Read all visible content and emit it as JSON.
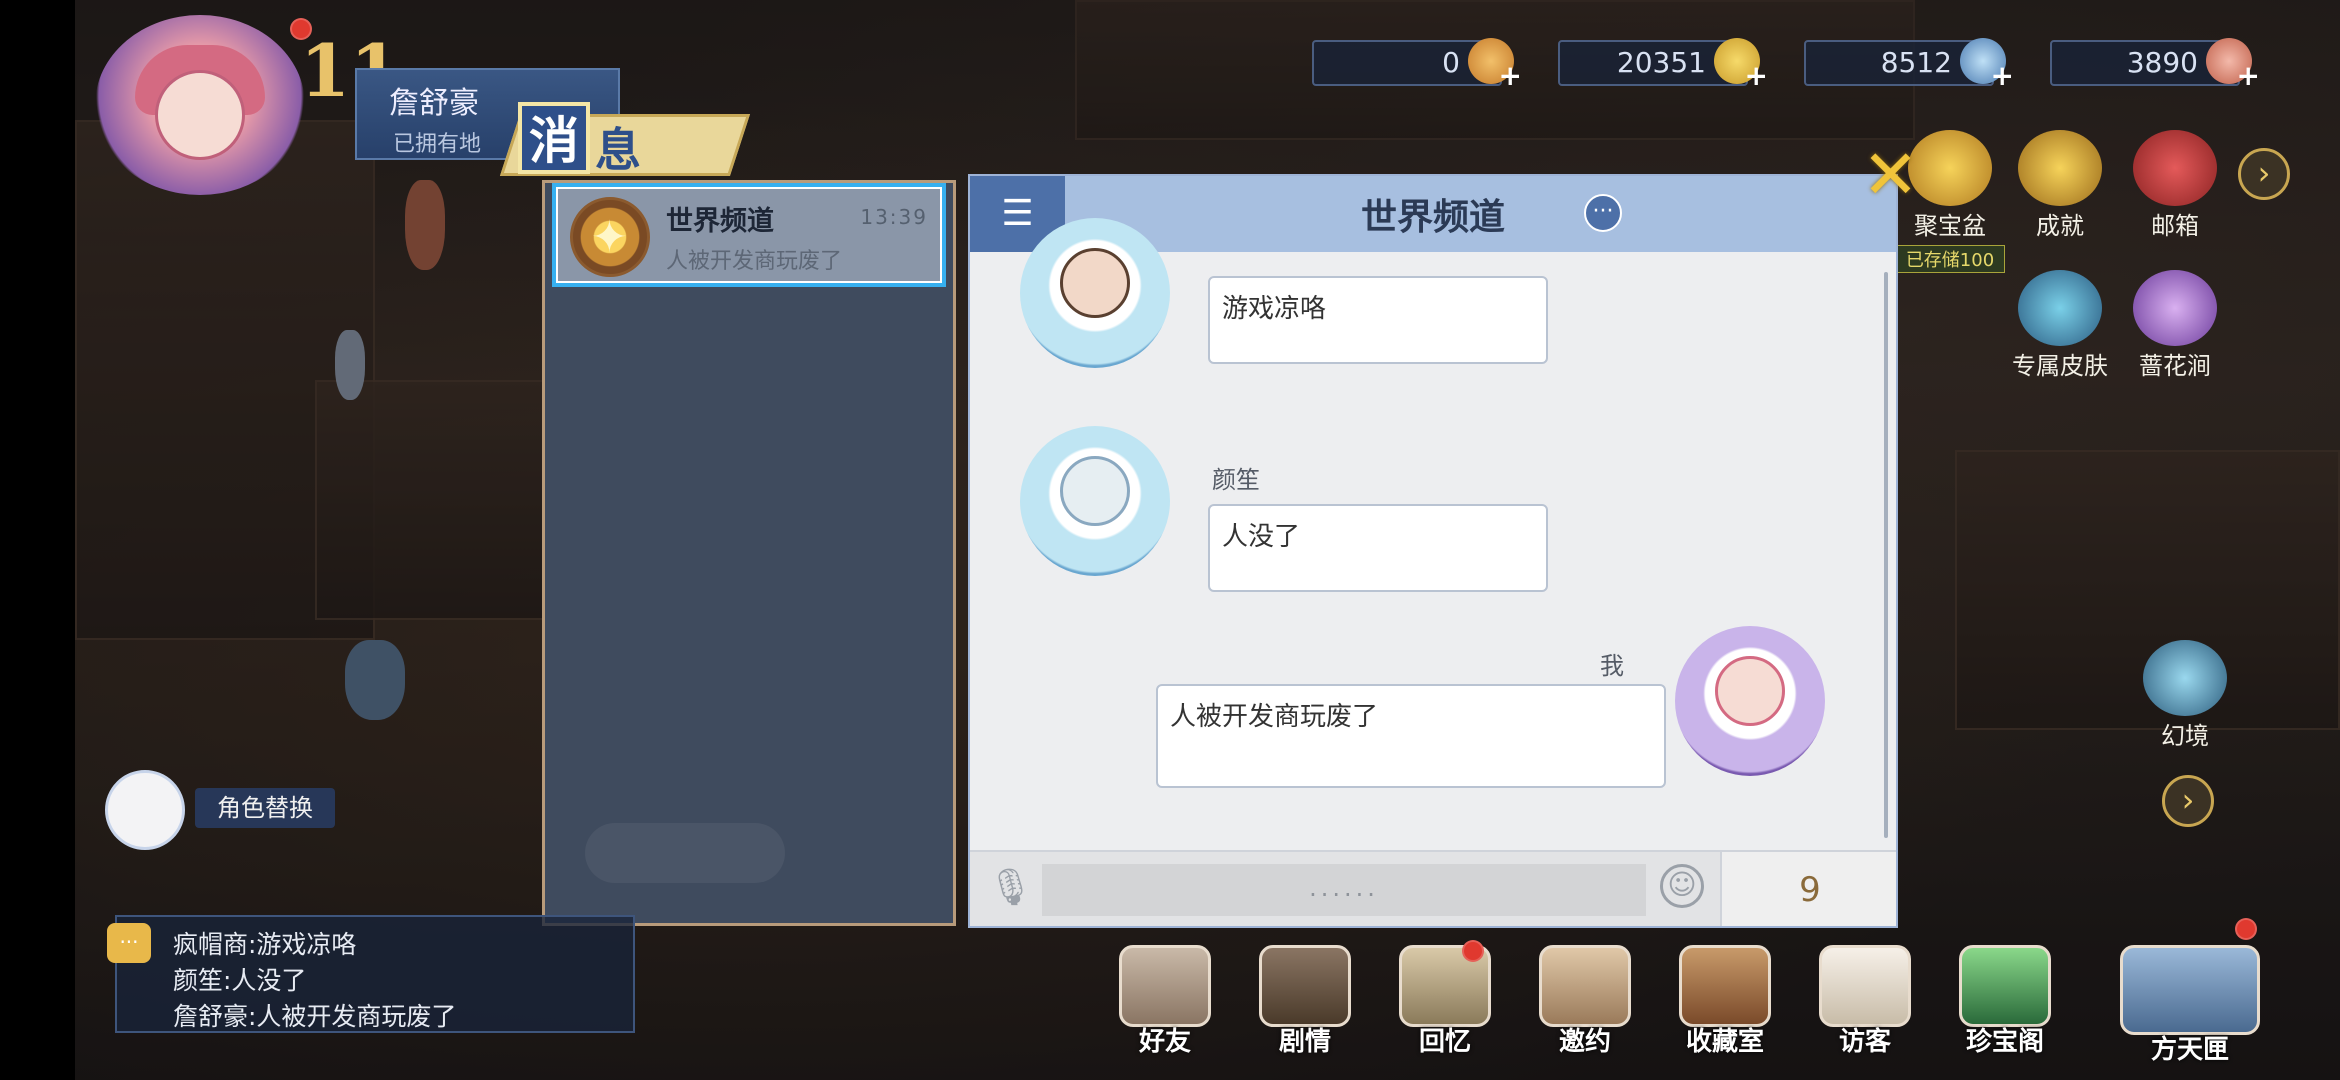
{
  "player": {
    "level": "11",
    "name": "詹舒豪",
    "subtitle": "已拥有地"
  },
  "resources": [
    {
      "value": "0",
      "icon": "feather-icon",
      "color": "#e6a64a"
    },
    {
      "value": "20351",
      "icon": "gold-coin-icon",
      "color": "#e8c24a"
    },
    {
      "value": "8512",
      "icon": "gem-icon",
      "color": "#7aa8d8"
    },
    {
      "value": "3890",
      "icon": "ticket-icon",
      "color": "#d88a7a"
    }
  ],
  "side_menu": [
    {
      "label": "聚宝盆",
      "note": "已存储100"
    },
    {
      "label": "成就"
    },
    {
      "label": "邮箱"
    },
    {
      "label": "专属皮肤"
    },
    {
      "label": "蔷花涧"
    },
    {
      "label": "幻境"
    }
  ],
  "message_window": {
    "title_char_1": "消",
    "title_char_2": "息"
  },
  "channels": [
    {
      "name": "世界频道",
      "time": "13:39",
      "last_message": "人被开发商玩废了"
    }
  ],
  "chat": {
    "title": "世界频道",
    "messages": [
      {
        "sender": "疯帽商",
        "text": "游戏凉咯",
        "mine": false
      },
      {
        "sender": "颜笙",
        "text": "人没了",
        "mine": false
      },
      {
        "sender": "我",
        "text": "人被开发商玩废了",
        "mine": true
      }
    ],
    "input_placeholder": "......",
    "char_count": "9"
  },
  "chat_log": [
    "疯帽商:游戏凉咯",
    "颜笙:人没了",
    "詹舒豪:人被开发商玩废了"
  ],
  "role_switch": {
    "label": "角色替换"
  },
  "dock": [
    "好友",
    "剧情",
    "回忆",
    "邀约",
    "收藏室",
    "访客",
    "珍宝阁",
    "方天匣"
  ],
  "colors": {
    "accent": "#36b0f0",
    "chat_header": "#a7bfe0",
    "header_button": "#4d70a8",
    "close": "#f0c43a"
  }
}
